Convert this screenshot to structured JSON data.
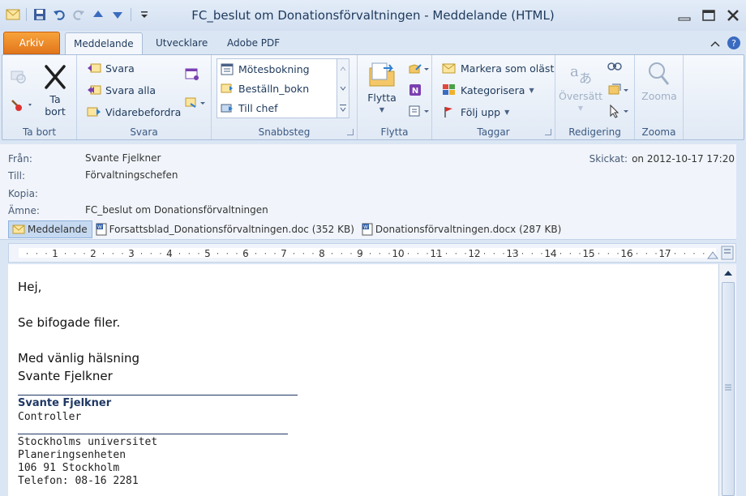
{
  "window": {
    "title": "FC_beslut om Donationsförvaltningen  -  Meddelande (HTML)"
  },
  "tabs": {
    "file": "Arkiv",
    "items": [
      "Meddelande",
      "Utvecklare",
      "Adobe PDF"
    ]
  },
  "ribbon": {
    "ta_bort": {
      "button": "Ta\nbort",
      "button_line1": "Ta",
      "button_line2": "bort",
      "label": "Ta bort"
    },
    "svara": {
      "reply": "Svara",
      "reply_all": "Svara alla",
      "forward": "Vidarebefordra",
      "label": "Svara"
    },
    "snabbsteg": {
      "items": [
        "Mötesbokning",
        "Beställn_bokn",
        "Till chef"
      ],
      "label": "Snabbsteg"
    },
    "flytta": {
      "button": "Flytta",
      "label": "Flytta"
    },
    "taggar": {
      "mark_unread": "Markera som oläst",
      "categorize": "Kategorisera",
      "follow_up": "Följ upp",
      "label": "Taggar"
    },
    "redigering": {
      "translate": "Översätt",
      "label": "Redigering"
    },
    "zooma": {
      "button": "Zooma",
      "label": "Zooma"
    }
  },
  "header": {
    "from_label": "Från:",
    "from": "Svante Fjelkner",
    "to_label": "Till:",
    "to": "Förvaltningschefen",
    "cc_label": "Kopia:",
    "cc": "",
    "subject_label": "Ämne:",
    "subject": "FC_beslut om Donationsförvaltningen",
    "sent_label": "Skickat:",
    "sent": "on 2012-10-17 17:20"
  },
  "attachments": [
    {
      "label": "Meddelande",
      "active": true
    },
    {
      "label": "Forsattsblad_Donationsförvaltningen.doc (352 KB)",
      "active": false
    },
    {
      "label": "Donationsförvaltningen.docx (287 KB)",
      "active": false
    }
  ],
  "ruler": {
    "ticks": [
      "1",
      "2",
      "3",
      "4",
      "5",
      "6",
      "7",
      "8",
      "9",
      "10",
      "11",
      "12",
      "13",
      "14",
      "15",
      "16",
      "17"
    ]
  },
  "body": {
    "greeting": "Hej,",
    "text": "Se bifogade filer.",
    "closing": "Med vänlig hälsning",
    "sender": "Svante Fjelkner"
  },
  "signature": {
    "name": "Svante Fjelkner",
    "title": "Controller",
    "org": "Stockholms universitet",
    "dept": "Planeringsenheten",
    "address": "106 91 Stockholm",
    "phone": "Telefon: 08-16 2281"
  },
  "colors": {
    "accent": "#e2761c",
    "signature": "#1f3864"
  }
}
